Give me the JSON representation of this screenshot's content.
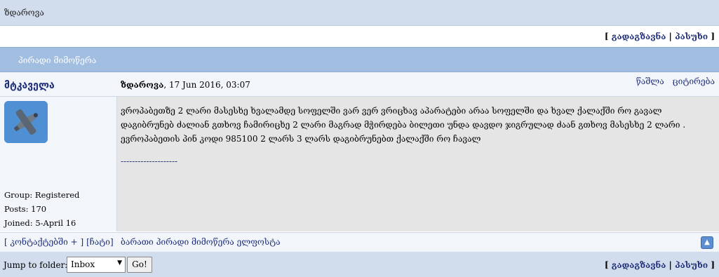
{
  "header": {
    "title": "ზდაროვა"
  },
  "actions": {
    "forward": "გადაგზავნა",
    "reply": "პასუხი"
  },
  "pm": {
    "title": "პირადი მიმოწერა"
  },
  "post": {
    "author": "მტკაველა",
    "subject": "ზდაროვა",
    "date": ", 17 Jun 2016, 03:07",
    "delete": "წაშლა",
    "quote": "ციტირება",
    "body": "ვროპაბეთზე 2 ლარი მასესხე ხვალამდე სოფელში ვარ ვერ ვრიცხავ აპარატები არაა სოფელში და ხვალ ქალაქში რო გავალ დაგიბრუნებ ძალიან გთხოვ ჩამირიცხე 2 ლარი მაგრად მჭირდება ბილეთი უნდა დავდო ჯიგრულად ძაან გთხოვ მასესხე 2 ლარი . ევროპაბეთის პინ კოდი 985100 2 ლარს 3 ლარს დაგიბრუნებთ ქალაქში რო ჩავალ",
    "signature": "--------------------"
  },
  "user": {
    "group": "Group: Registered",
    "posts": "Posts: 170",
    "joined": "Joined: 5-April 16"
  },
  "footer": {
    "contacts": "[ კონტაქტებში + ]",
    "block": "[ჩატი]",
    "notice": "ბარათი პირადი მიმოწერა ელფოსტა"
  },
  "jump": {
    "label": "Jump to folder:",
    "selected": "Inbox",
    "go": "Go!"
  }
}
